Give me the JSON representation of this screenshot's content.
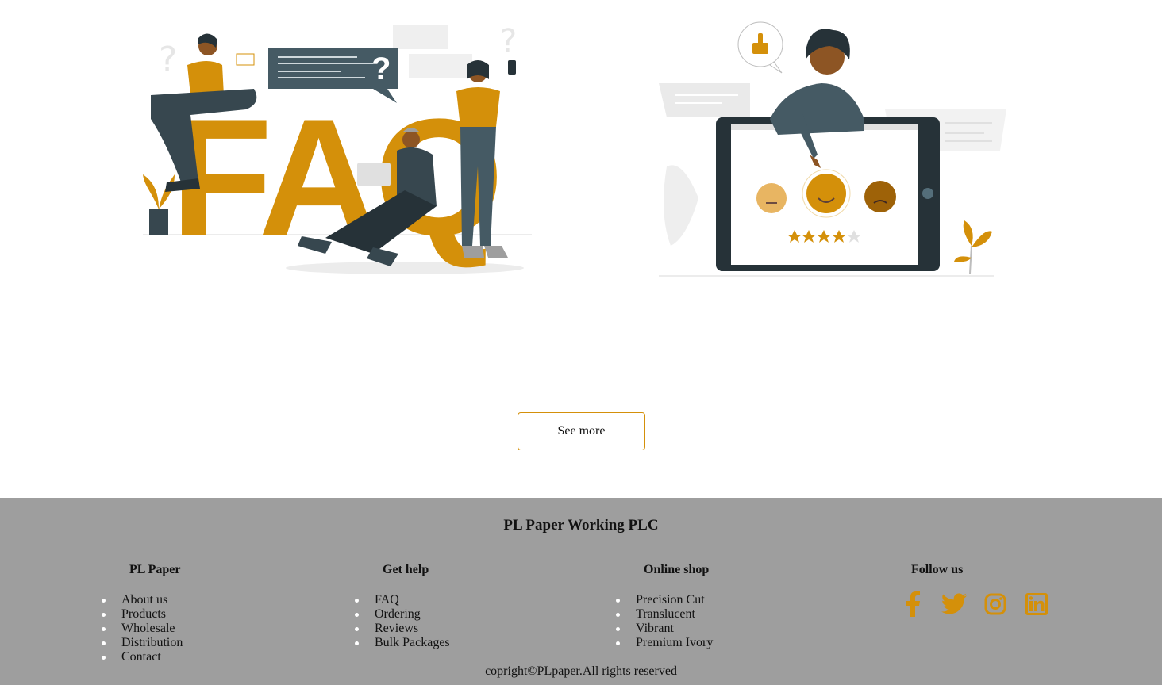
{
  "buttons": {
    "see_more": "See more"
  },
  "illustrations": {
    "faq_letters": "FAQ",
    "faq_question_mark": "?"
  },
  "footer": {
    "company": "PL Paper Working PLC",
    "columns": [
      {
        "title": "PL Paper",
        "items": [
          "About us",
          "Products",
          "Wholesale",
          "Distribution",
          "Contact"
        ]
      },
      {
        "title": "Get help",
        "items": [
          "FAQ",
          "Ordering",
          "Reviews",
          "Bulk Packages"
        ]
      },
      {
        "title": "Online shop",
        "items": [
          "Precision Cut",
          "Translucent",
          "Vibrant",
          "Premium Ivory"
        ]
      },
      {
        "title": "Follow us",
        "icons": [
          "facebook-icon",
          "twitter-icon",
          "instagram-icon",
          "linkedin-icon"
        ]
      }
    ],
    "copyright": "copright©PLpaper.All rights reserved"
  },
  "colors": {
    "accent": "#d4900a",
    "footer_bg": "#9e9e9e",
    "dark": "#37474f"
  }
}
